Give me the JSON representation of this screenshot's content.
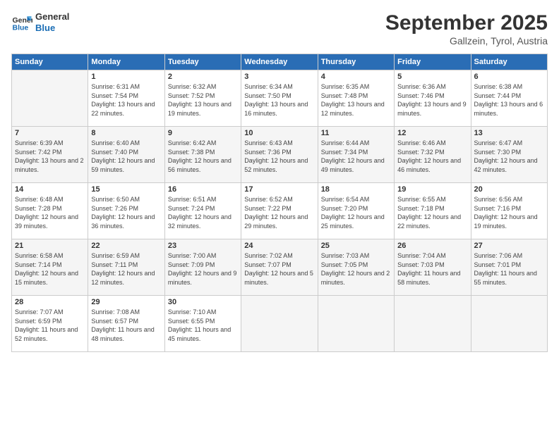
{
  "header": {
    "logo_general": "General",
    "logo_blue": "Blue",
    "month": "September 2025",
    "location": "Gallzein, Tyrol, Austria"
  },
  "columns": [
    "Sunday",
    "Monday",
    "Tuesday",
    "Wednesday",
    "Thursday",
    "Friday",
    "Saturday"
  ],
  "rows": [
    [
      {
        "day": "",
        "empty": true
      },
      {
        "day": "1",
        "sunrise": "6:31 AM",
        "sunset": "7:54 PM",
        "daylight": "13 hours and 22 minutes."
      },
      {
        "day": "2",
        "sunrise": "6:32 AM",
        "sunset": "7:52 PM",
        "daylight": "13 hours and 19 minutes."
      },
      {
        "day": "3",
        "sunrise": "6:34 AM",
        "sunset": "7:50 PM",
        "daylight": "13 hours and 16 minutes."
      },
      {
        "day": "4",
        "sunrise": "6:35 AM",
        "sunset": "7:48 PM",
        "daylight": "13 hours and 12 minutes."
      },
      {
        "day": "5",
        "sunrise": "6:36 AM",
        "sunset": "7:46 PM",
        "daylight": "13 hours and 9 minutes."
      },
      {
        "day": "6",
        "sunrise": "6:38 AM",
        "sunset": "7:44 PM",
        "daylight": "13 hours and 6 minutes."
      }
    ],
    [
      {
        "day": "7",
        "sunrise": "6:39 AM",
        "sunset": "7:42 PM",
        "daylight": "13 hours and 2 minutes."
      },
      {
        "day": "8",
        "sunrise": "6:40 AM",
        "sunset": "7:40 PM",
        "daylight": "12 hours and 59 minutes."
      },
      {
        "day": "9",
        "sunrise": "6:42 AM",
        "sunset": "7:38 PM",
        "daylight": "12 hours and 56 minutes."
      },
      {
        "day": "10",
        "sunrise": "6:43 AM",
        "sunset": "7:36 PM",
        "daylight": "12 hours and 52 minutes."
      },
      {
        "day": "11",
        "sunrise": "6:44 AM",
        "sunset": "7:34 PM",
        "daylight": "12 hours and 49 minutes."
      },
      {
        "day": "12",
        "sunrise": "6:46 AM",
        "sunset": "7:32 PM",
        "daylight": "12 hours and 46 minutes."
      },
      {
        "day": "13",
        "sunrise": "6:47 AM",
        "sunset": "7:30 PM",
        "daylight": "12 hours and 42 minutes."
      }
    ],
    [
      {
        "day": "14",
        "sunrise": "6:48 AM",
        "sunset": "7:28 PM",
        "daylight": "12 hours and 39 minutes."
      },
      {
        "day": "15",
        "sunrise": "6:50 AM",
        "sunset": "7:26 PM",
        "daylight": "12 hours and 36 minutes."
      },
      {
        "day": "16",
        "sunrise": "6:51 AM",
        "sunset": "7:24 PM",
        "daylight": "12 hours and 32 minutes."
      },
      {
        "day": "17",
        "sunrise": "6:52 AM",
        "sunset": "7:22 PM",
        "daylight": "12 hours and 29 minutes."
      },
      {
        "day": "18",
        "sunrise": "6:54 AM",
        "sunset": "7:20 PM",
        "daylight": "12 hours and 25 minutes."
      },
      {
        "day": "19",
        "sunrise": "6:55 AM",
        "sunset": "7:18 PM",
        "daylight": "12 hours and 22 minutes."
      },
      {
        "day": "20",
        "sunrise": "6:56 AM",
        "sunset": "7:16 PM",
        "daylight": "12 hours and 19 minutes."
      }
    ],
    [
      {
        "day": "21",
        "sunrise": "6:58 AM",
        "sunset": "7:14 PM",
        "daylight": "12 hours and 15 minutes."
      },
      {
        "day": "22",
        "sunrise": "6:59 AM",
        "sunset": "7:11 PM",
        "daylight": "12 hours and 12 minutes."
      },
      {
        "day": "23",
        "sunrise": "7:00 AM",
        "sunset": "7:09 PM",
        "daylight": "12 hours and 9 minutes."
      },
      {
        "day": "24",
        "sunrise": "7:02 AM",
        "sunset": "7:07 PM",
        "daylight": "12 hours and 5 minutes."
      },
      {
        "day": "25",
        "sunrise": "7:03 AM",
        "sunset": "7:05 PM",
        "daylight": "12 hours and 2 minutes."
      },
      {
        "day": "26",
        "sunrise": "7:04 AM",
        "sunset": "7:03 PM",
        "daylight": "11 hours and 58 minutes."
      },
      {
        "day": "27",
        "sunrise": "7:06 AM",
        "sunset": "7:01 PM",
        "daylight": "11 hours and 55 minutes."
      }
    ],
    [
      {
        "day": "28",
        "sunrise": "7:07 AM",
        "sunset": "6:59 PM",
        "daylight": "11 hours and 52 minutes."
      },
      {
        "day": "29",
        "sunrise": "7:08 AM",
        "sunset": "6:57 PM",
        "daylight": "11 hours and 48 minutes."
      },
      {
        "day": "30",
        "sunrise": "7:10 AM",
        "sunset": "6:55 PM",
        "daylight": "11 hours and 45 minutes."
      },
      {
        "day": "",
        "empty": true
      },
      {
        "day": "",
        "empty": true
      },
      {
        "day": "",
        "empty": true
      },
      {
        "day": "",
        "empty": true
      }
    ]
  ]
}
